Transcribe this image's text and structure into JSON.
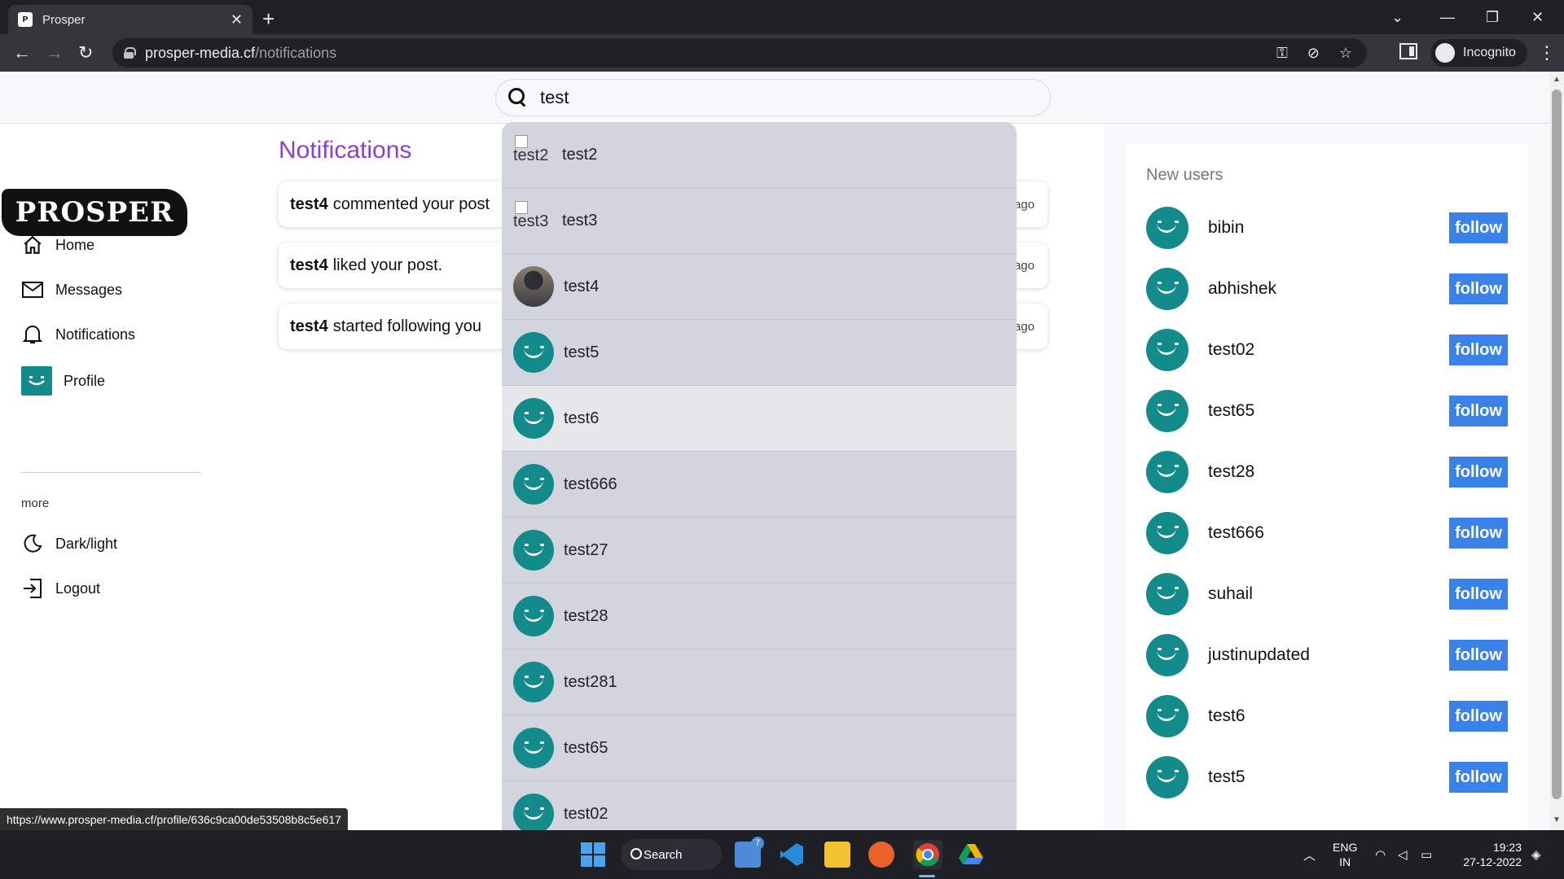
{
  "browser": {
    "tab_title": "Prosper",
    "favicon_text": "P",
    "url_host": "prosper-media.cf",
    "url_path": "/notifications",
    "incognito_label": "Incognito",
    "status_url": "https://www.prosper-media.cf/profile/636c9ca00de53508b8c5e617"
  },
  "search": {
    "value": "test"
  },
  "sidebar": {
    "logo": "PROSPER",
    "items": [
      {
        "label": "Home",
        "icon": "home-icon"
      },
      {
        "label": "Messages",
        "icon": "mail-icon"
      },
      {
        "label": "Notifications",
        "icon": "bell-icon"
      },
      {
        "label": "Profile",
        "icon": "avatar"
      }
    ],
    "more_label": "more",
    "more_items": [
      {
        "label": "Dark/light",
        "icon": "moon-icon"
      },
      {
        "label": "Logout",
        "icon": "logout-icon"
      }
    ]
  },
  "notifications": {
    "title": "Notifications",
    "items": [
      {
        "user": "test4",
        "text": "commented your post",
        "ago": "ago"
      },
      {
        "user": "test4",
        "text": "liked your post.",
        "ago": "ago"
      },
      {
        "user": "test4",
        "text": "started following you",
        "ago": "ago"
      }
    ]
  },
  "search_results": [
    {
      "name": "test2",
      "avatar": "broken-image",
      "alt": "test2"
    },
    {
      "name": "test3",
      "avatar": "broken-image",
      "alt": "test3"
    },
    {
      "name": "test4",
      "avatar": "photo"
    },
    {
      "name": "test5",
      "avatar": "smiley"
    },
    {
      "name": "test6",
      "avatar": "smiley"
    },
    {
      "name": "test666",
      "avatar": "smiley"
    },
    {
      "name": "test27",
      "avatar": "smiley"
    },
    {
      "name": "test28",
      "avatar": "smiley"
    },
    {
      "name": "test281",
      "avatar": "smiley"
    },
    {
      "name": "test65",
      "avatar": "smiley"
    },
    {
      "name": "test02",
      "avatar": "smiley"
    }
  ],
  "new_users": {
    "title": "New users",
    "follow_label": "follow",
    "users": [
      "bibin",
      "abhishek",
      "test02",
      "test65",
      "test28",
      "test666",
      "suhail",
      "justinupdated",
      "test6",
      "test5"
    ]
  },
  "taskbar": {
    "search_label": "Search",
    "mail_badge": "7",
    "lang_top": "ENG",
    "lang_bottom": "IN",
    "time": "19:23",
    "date": "27-12-2022"
  },
  "colors": {
    "accent_purple": "#8a3fd1",
    "follow_blue": "#3b82e8",
    "avatar_teal": "#138b8b"
  }
}
